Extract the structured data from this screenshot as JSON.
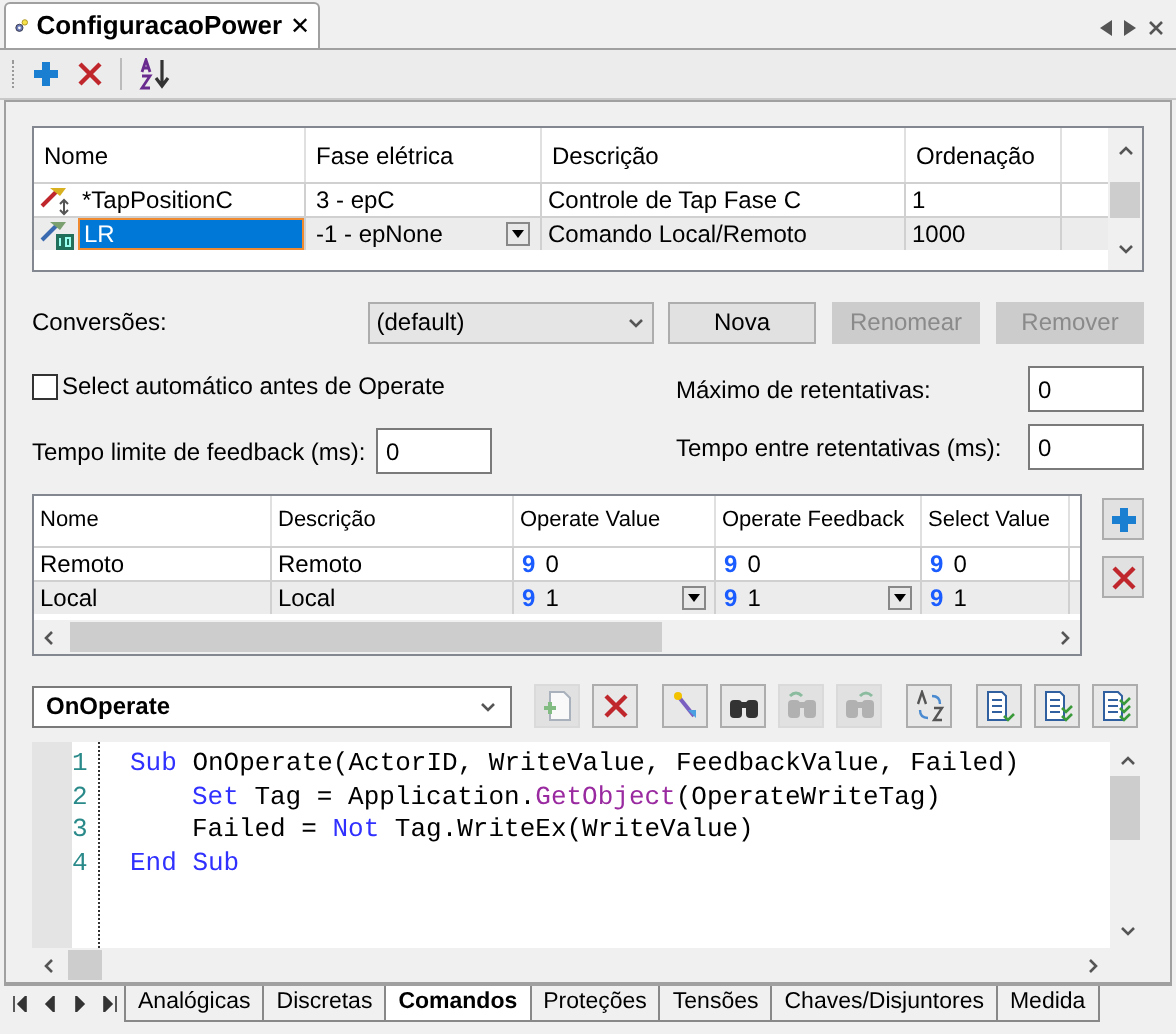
{
  "doc_tab": {
    "title": "ConfiguracaoPower",
    "close": "✕"
  },
  "toolbar": [
    {
      "kind": "add"
    },
    {
      "kind": "delete"
    },
    {
      "kind": "sort"
    }
  ],
  "top_table": {
    "columns": [
      "Nome",
      "Fase elétrica",
      "Descrição",
      "Ordenação"
    ],
    "rows": [
      {
        "kind": "tap",
        "selected": false,
        "name": "*TapPositionC",
        "phase": "3 - epC",
        "description": "Controle de Tap Fase C",
        "order": "1"
      },
      {
        "kind": "digital",
        "selected": true,
        "name": "LR",
        "phase": "-1 - epNone",
        "description": "Comando Local/Remoto",
        "order": "1000"
      }
    ]
  },
  "conversions": {
    "label": "Conversões:",
    "value": "(default)",
    "buttons": [
      {
        "label": "Nova",
        "disabled": false
      },
      {
        "label": "Renomear",
        "disabled": true
      },
      {
        "label": "Remover",
        "disabled": true
      }
    ]
  },
  "auto_select": {
    "label": "Select automático antes de Operate",
    "checked": false
  },
  "max_retries": {
    "label": "Máximo de retentativas:",
    "value": "0"
  },
  "feedback_timeout": {
    "label": "Tempo limite de feedback (ms):",
    "value": "0"
  },
  "retry_interval": {
    "label": "Tempo entre retentativas (ms):",
    "value": "0"
  },
  "states_table": {
    "columns": [
      "Nome",
      "Descrição",
      "Operate Value",
      "Operate Feedback",
      "Select Value"
    ],
    "rows": [
      {
        "selected": false,
        "name": "Remoto",
        "description": "Remoto",
        "operate_value": {
          "glyph": "9",
          "value": "0"
        },
        "operate_feedback": {
          "glyph": "9",
          "value": "0"
        },
        "select_value": {
          "glyph": "9",
          "value": "0"
        }
      },
      {
        "selected": true,
        "name": "Local",
        "description": "Local",
        "operate_value": {
          "glyph": "9",
          "value": "1"
        },
        "operate_feedback": {
          "glyph": "9",
          "value": "1"
        },
        "select_value": {
          "glyph": "9",
          "value": "1"
        }
      }
    ]
  },
  "script": {
    "event": "OnOperate",
    "toolbar": [
      {
        "kind": "new-doc",
        "disabled": true
      },
      {
        "kind": "delete",
        "disabled": false
      },
      {
        "kind": "wand",
        "disabled": false
      },
      {
        "kind": "find",
        "disabled": false
      },
      {
        "kind": "find-prev",
        "disabled": true
      },
      {
        "kind": "find-next",
        "disabled": true
      },
      {
        "kind": "replace",
        "disabled": false
      },
      {
        "kind": "doc-check",
        "disabled": false
      },
      {
        "kind": "doc-check2",
        "disabled": false
      },
      {
        "kind": "doc-check3",
        "disabled": false
      }
    ],
    "lines": [
      {
        "number": "1",
        "tokens": [
          {
            "kind": "keyword",
            "text": "Sub"
          },
          {
            "kind": "plain",
            "text": " OnOperate(ActorID, WriteValue, FeedbackValue, Failed)"
          }
        ],
        "children": [
          {
            "number": "2",
            "tokens": [
              {
                "kind": "keyword",
                "text": "Set"
              },
              {
                "kind": "plain",
                "text": " Tag = Application."
              },
              {
                "kind": "method",
                "text": "GetObject"
              },
              {
                "kind": "plain",
                "text": "(OperateWriteTag)"
              }
            ]
          },
          {
            "number": "3",
            "tokens": [
              {
                "kind": "plain",
                "text": "Failed = "
              },
              {
                "kind": "keyword",
                "text": "Not"
              },
              {
                "kind": "plain",
                "text": " Tag.WriteEx(WriteValue)"
              }
            ]
          }
        ]
      },
      {
        "number": "4",
        "tokens": [
          {
            "kind": "keyword",
            "text": "End Sub"
          }
        ]
      }
    ]
  },
  "sheet_tabs": [
    {
      "label": "Analógicas",
      "selected": false
    },
    {
      "label": "Discretas",
      "selected": false
    },
    {
      "label": "Comandos",
      "selected": true
    },
    {
      "label": "Proteções",
      "selected": false
    },
    {
      "label": "Tensões",
      "selected": false
    },
    {
      "label": "Chaves/Disjuntores",
      "selected": false
    },
    {
      "label": "Medida",
      "selected": false
    }
  ]
}
